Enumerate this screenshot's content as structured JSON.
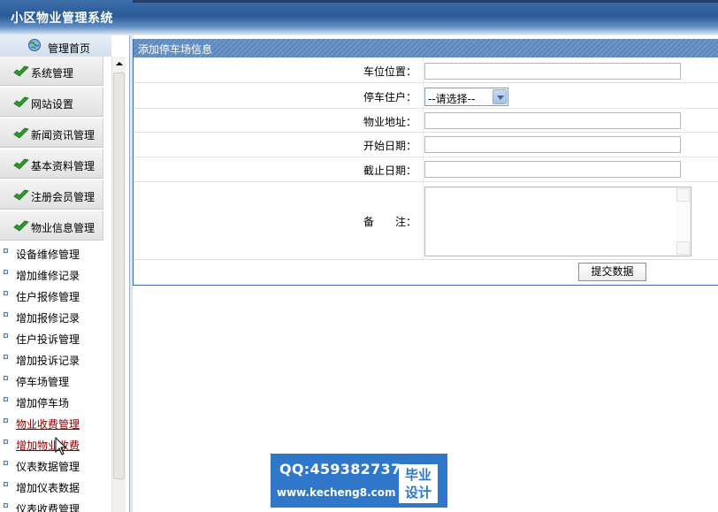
{
  "app": {
    "title": "小区物业管理系统"
  },
  "sidebar": {
    "home_label": "管理首页",
    "menus": [
      {
        "label": "系统管理"
      },
      {
        "label": "网站设置"
      },
      {
        "label": "新闻资讯管理"
      },
      {
        "label": "基本资料管理"
      },
      {
        "label": "注册会员管理"
      },
      {
        "label": "物业信息管理"
      }
    ],
    "sub_items": [
      {
        "label": "设备维修管理"
      },
      {
        "label": "增加维修记录"
      },
      {
        "label": "住户报修管理"
      },
      {
        "label": "增加报修记录"
      },
      {
        "label": "住户投诉管理"
      },
      {
        "label": "增加投诉记录"
      },
      {
        "label": "停车场管理"
      },
      {
        "label": "增加停车场"
      },
      {
        "label": "物业收费管理"
      },
      {
        "label": "增加物业收费"
      },
      {
        "label": "仪表数据管理"
      },
      {
        "label": "增加仪表数据"
      },
      {
        "label": "仪表收费管理"
      }
    ]
  },
  "form": {
    "title": "添加停车场信息",
    "fields": {
      "parking_space": {
        "label": "车位位置：",
        "value": ""
      },
      "resident": {
        "label": "停车住户：",
        "selected": "--请选择--"
      },
      "address": {
        "label": "物业地址：",
        "value": ""
      },
      "start_date": {
        "label": "开始日期：",
        "value": ""
      },
      "end_date": {
        "label": "截止日期：",
        "value": ""
      },
      "remark": {
        "label": "备　　注：",
        "value": ""
      }
    },
    "submit_label": "提交数据"
  },
  "watermark": {
    "qq": "QQ:459382737",
    "url": "www.kecheng8.com",
    "badge_line1": "毕业",
    "badge_line2": "设计"
  },
  "colors": {
    "header_blue": "#2a5a97",
    "panel_head": "#5a86bd",
    "watermark_blue": "#2f77c9",
    "active_link": "#8b0000"
  }
}
